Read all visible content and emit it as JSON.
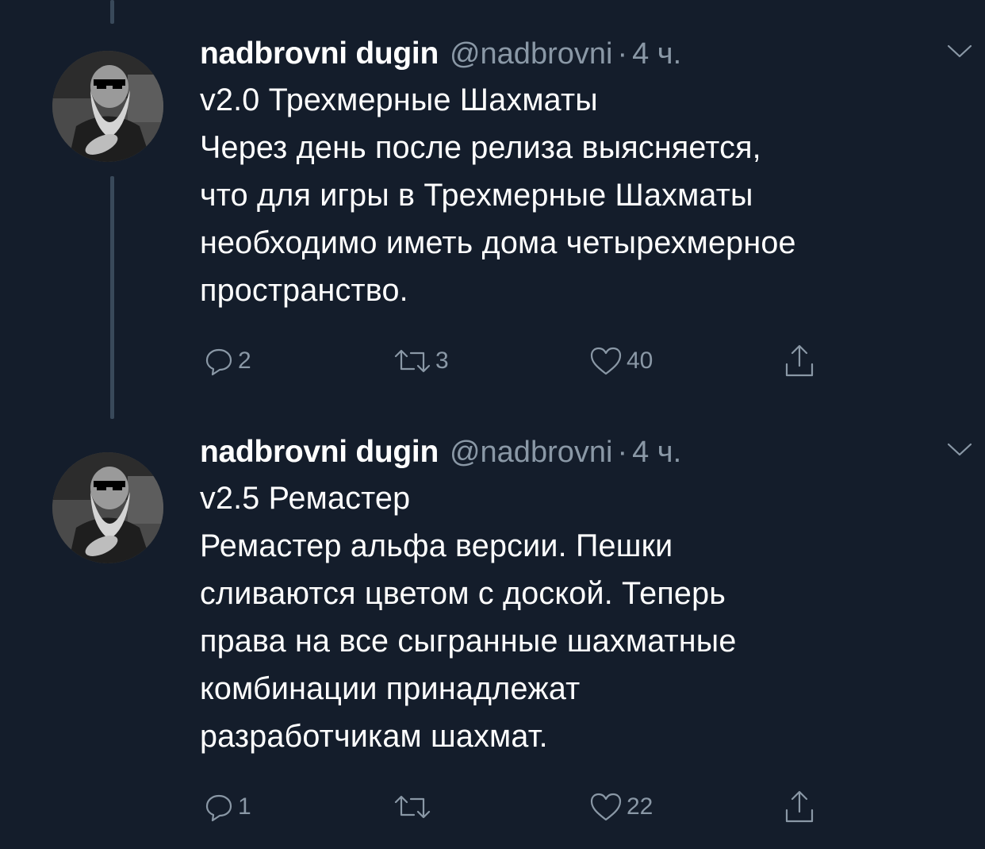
{
  "colors": {
    "background": "#141d2b",
    "thread_line": "#39495a",
    "secondary_text": "#8a98a6",
    "primary_text": "#ffffff"
  },
  "tweets": [
    {
      "display_name": "nadbrovni dugin",
      "handle": "@nadbrovni",
      "separator": "·",
      "time": "4 ч.",
      "lines": [
        "v2.0 Трехмерные Шахматы",
        "Через день после релиза выясняется,",
        "что для игры в Трехмерные Шахматы",
        "необходимо иметь дома четырехмерное",
        "пространство."
      ],
      "replies": "2",
      "retweets": "3",
      "likes": "40",
      "icons": [
        "avatar-image",
        "chevron-down-icon",
        "reply-icon",
        "retweet-icon",
        "like-icon",
        "share-icon"
      ]
    },
    {
      "display_name": "nadbrovni dugin",
      "handle": "@nadbrovni",
      "separator": "·",
      "time": "4 ч.",
      "lines": [
        "v2.5 Ремастер",
        "Ремастер альфа версии. Пешки",
        "сливаются цветом с доской. Теперь",
        "права на все сыгранные шахматные",
        "комбинации принадлежат",
        "разработчикам шахмат."
      ],
      "replies": "1",
      "retweets": "",
      "likes": "22",
      "icons": [
        "avatar-image",
        "chevron-down-icon",
        "reply-icon",
        "retweet-icon",
        "like-icon",
        "share-icon"
      ]
    }
  ]
}
